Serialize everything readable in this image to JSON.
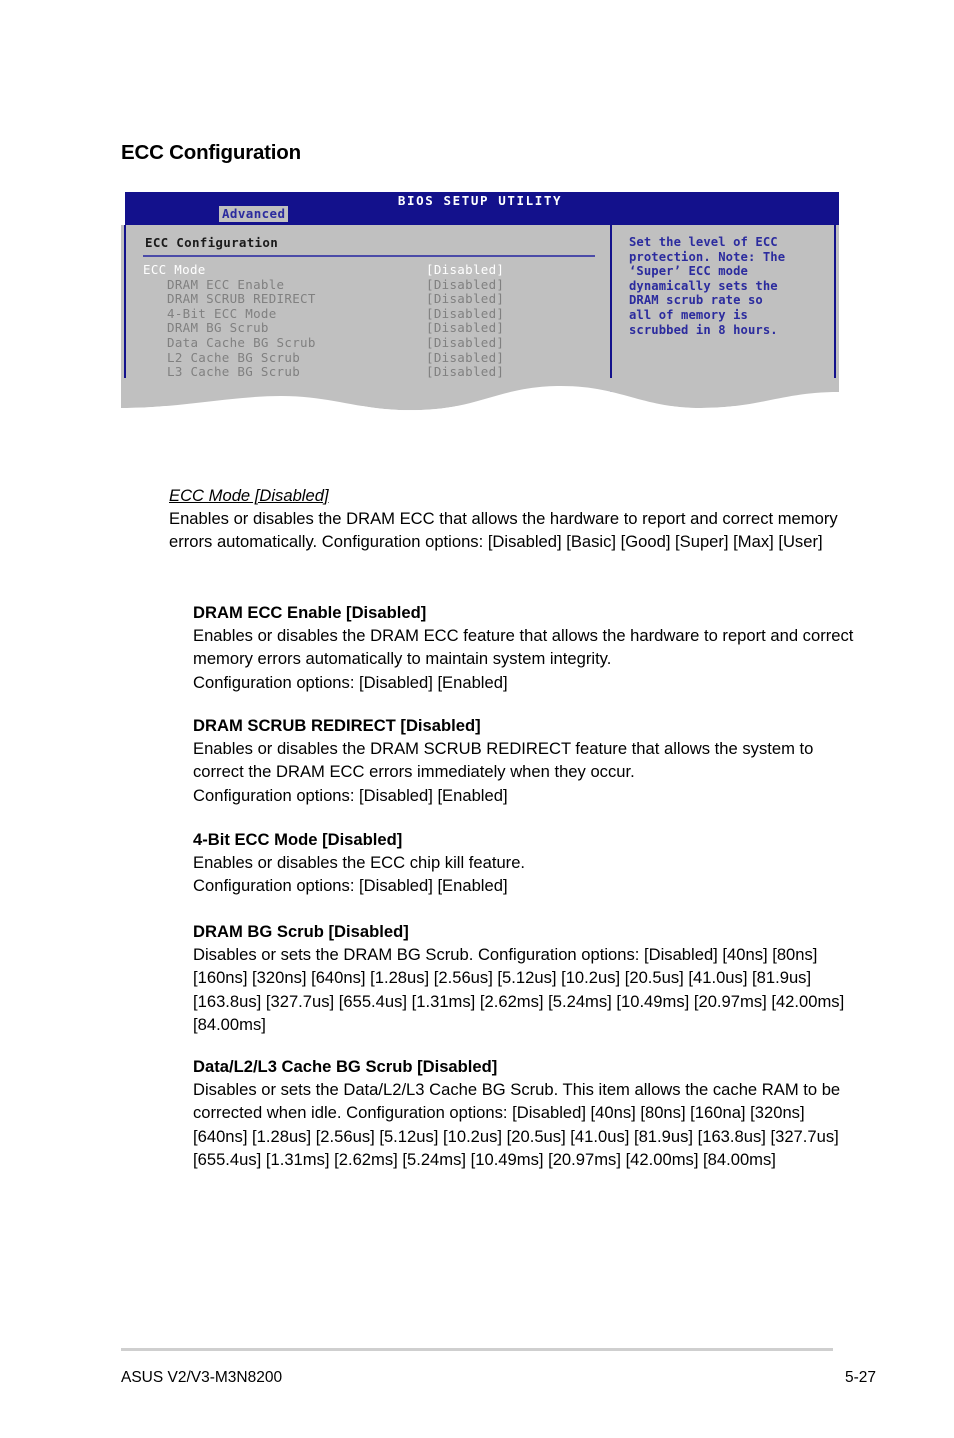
{
  "page": {
    "heading": "ECC Configuration"
  },
  "bios": {
    "title": "BIOS SETUP UTILITY",
    "tab": "Advanced",
    "pane_title": "ECC Configuration",
    "colors": {
      "titlebar": "#13118c",
      "panel": "#c0c0c0",
      "border": "#13118c",
      "rule": "#4b4ba8",
      "help_text": "#2b2b9e",
      "selected_text": "#ffffff",
      "dim_text": "#808080",
      "tab_bg": "#c0c0c0"
    },
    "items": [
      {
        "label": "ECC Mode",
        "value": "[Disabled]",
        "selected": true,
        "indent": false
      },
      {
        "label": "DRAM ECC Enable",
        "value": "[Disabled]",
        "selected": false,
        "indent": true
      },
      {
        "label": "DRAM SCRUB REDIRECT",
        "value": "[Disabled]",
        "selected": false,
        "indent": true
      },
      {
        "label": "4-Bit ECC Mode",
        "value": "[Disabled]",
        "selected": false,
        "indent": true
      },
      {
        "label": "DRAM BG Scrub",
        "value": "[Disabled]",
        "selected": false,
        "indent": true
      },
      {
        "label": "Data Cache BG Scrub",
        "value": "[Disabled]",
        "selected": false,
        "indent": true
      },
      {
        "label": "L2 Cache BG Scrub",
        "value": "[Disabled]",
        "selected": false,
        "indent": true
      },
      {
        "label": "L3 Cache BG Scrub",
        "value": "[Disabled]",
        "selected": false,
        "indent": true
      }
    ],
    "help": "Set the level of ECC\nprotection. Note: The\n‘Super’ ECC mode\ndynamically sets the\nDRAM scrub rate so\nall of memory is\nscrubbed in 8 hours."
  },
  "sections": [
    {
      "heading": "ECC Mode [Disabled]",
      "heading_style": "italic-underline",
      "level": 1,
      "body": "Enables or disables the DRAM ECC that allows the hardware to report and correct memory errors automatically. Configuration options: [Disabled] [Basic] [Good] [Super] [Max] [User]"
    },
    {
      "heading": "DRAM ECC Enable [Disabled]",
      "heading_style": "bold",
      "level": 2,
      "body": "Enables or disables the DRAM ECC feature that allows the hardware to report and correct memory errors automatically to maintain system integrity.\nConfiguration options: [Disabled] [Enabled]"
    },
    {
      "heading": "DRAM SCRUB REDIRECT [Disabled]",
      "heading_style": "bold",
      "level": 2,
      "body": "Enables or disables the DRAM SCRUB REDIRECT feature that allows the system to correct the DRAM ECC errors immediately when they occur.\nConfiguration options: [Disabled] [Enabled]"
    },
    {
      "heading": "4-Bit ECC Mode [Disabled]",
      "heading_style": "bold",
      "level": 2,
      "body": "Enables or disables the ECC chip kill feature.\nConfiguration options: [Disabled] [Enabled]"
    },
    {
      "heading": "DRAM BG Scrub [Disabled]",
      "heading_style": "bold",
      "level": 2,
      "body": "Disables or sets the DRAM BG Scrub. Configuration options: [Disabled] [40ns] [80ns] [160ns] [320ns] [640ns] [1.28us] [2.56us] [5.12us] [10.2us] [20.5us] [41.0us] [81.9us] [163.8us] [327.7us] [655.4us] [1.31ms] [2.62ms] [5.24ms] [10.49ms] [20.97ms] [42.00ms] [84.00ms]"
    },
    {
      "heading": "Data/L2/L3 Cache BG Scrub [Disabled]",
      "heading_style": "bold",
      "level": 2,
      "body": "Disables or sets the Data/L2/L3 Cache BG Scrub. This item allows the cache RAM to be corrected when idle. Configuration options: [Disabled] [40ns] [80ns] [160na] [320ns] [640ns] [1.28us] [2.56us] [5.12us] [10.2us] [20.5us] [41.0us] [81.9us] [163.8us] [327.7us] [655.4us] [1.31ms] [2.62ms] [5.24ms] [10.49ms] [20.97ms] [42.00ms] [84.00ms]"
    }
  ],
  "footer": {
    "left": "ASUS V2/V3-M3N8200",
    "right": "5-27"
  }
}
